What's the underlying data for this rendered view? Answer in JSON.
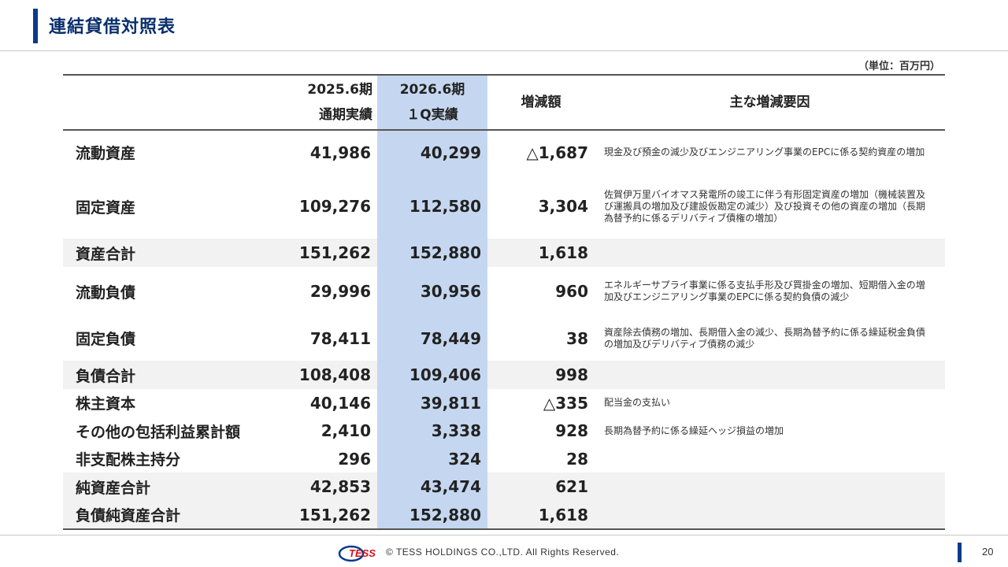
{
  "page_title": "連結貸借対照表",
  "unit_note": "（単位：百万円）",
  "header": {
    "col_2025_line1": "2025.6期",
    "col_2025_line2": "通期実績",
    "col_2026_line1": "2026.6期",
    "col_2026_line2": "１Q実績",
    "col_diff": "増減額",
    "col_reason": "主な増減要因"
  },
  "rows": [
    {
      "label": "流動資産",
      "v2025": "41,986",
      "v2026": "40,299",
      "diff": "△1,687",
      "reason": "現金及び預金の減少及びエンジニアリング事業のEPCに係る契約資産の増加"
    },
    {
      "label": "固定資産",
      "v2025": "109,276",
      "v2026": "112,580",
      "diff": "3,304",
      "reason": "佐賀伊万里バイオマス発電所の竣工に伴う有形固定資産の増加（機械装置及び運搬具の増加及び建設仮勘定の減少）及び投資その他の資産の増加（長期為替予約に係るデリバティブ債権の増加）"
    },
    {
      "label": "資産合計",
      "v2025": "151,262",
      "v2026": "152,880",
      "diff": "1,618",
      "reason": ""
    },
    {
      "label": "流動負債",
      "v2025": "29,996",
      "v2026": "30,956",
      "diff": "960",
      "reason": "エネルギーサプライ事業に係る支払手形及び買掛金の増加、短期借入金の増加及びエンジニアリング事業のEPCに係る契約負債の減少"
    },
    {
      "label": "固定負債",
      "v2025": "78,411",
      "v2026": "78,449",
      "diff": "38",
      "reason": "資産除去債務の増加、長期借入金の減少、長期為替予約に係る繰延税金負債の増加及びデリバティブ債務の減少"
    },
    {
      "label": "負債合計",
      "v2025": "108,408",
      "v2026": "109,406",
      "diff": "998",
      "reason": ""
    },
    {
      "label": "株主資本",
      "v2025": "40,146",
      "v2026": "39,811",
      "diff": "△335",
      "reason": "配当金の支払い"
    },
    {
      "label": "その他の包括利益累計額",
      "v2025": "2,410",
      "v2026": "3,338",
      "diff": "928",
      "reason": "長期為替予約に係る繰延ヘッジ損益の増加"
    },
    {
      "label": "非支配株主持分",
      "v2025": "296",
      "v2026": "324",
      "diff": "28",
      "reason": ""
    },
    {
      "label": "純資産合計",
      "v2025": "42,853",
      "v2026": "43,474",
      "diff": "621",
      "reason": ""
    },
    {
      "label": "負債純資産合計",
      "v2025": "151,262",
      "v2026": "152,880",
      "diff": "1,618",
      "reason": ""
    }
  ],
  "footer": {
    "logo_text": "TESS",
    "copyright": "© TESS HOLDINGS CO.,LTD. All Rights Reserved.",
    "page_number": "20"
  },
  "colors": {
    "accent": "#0a3a8c",
    "highlight_column": "#c5d7f0",
    "total_row": "#f2f2f2"
  }
}
